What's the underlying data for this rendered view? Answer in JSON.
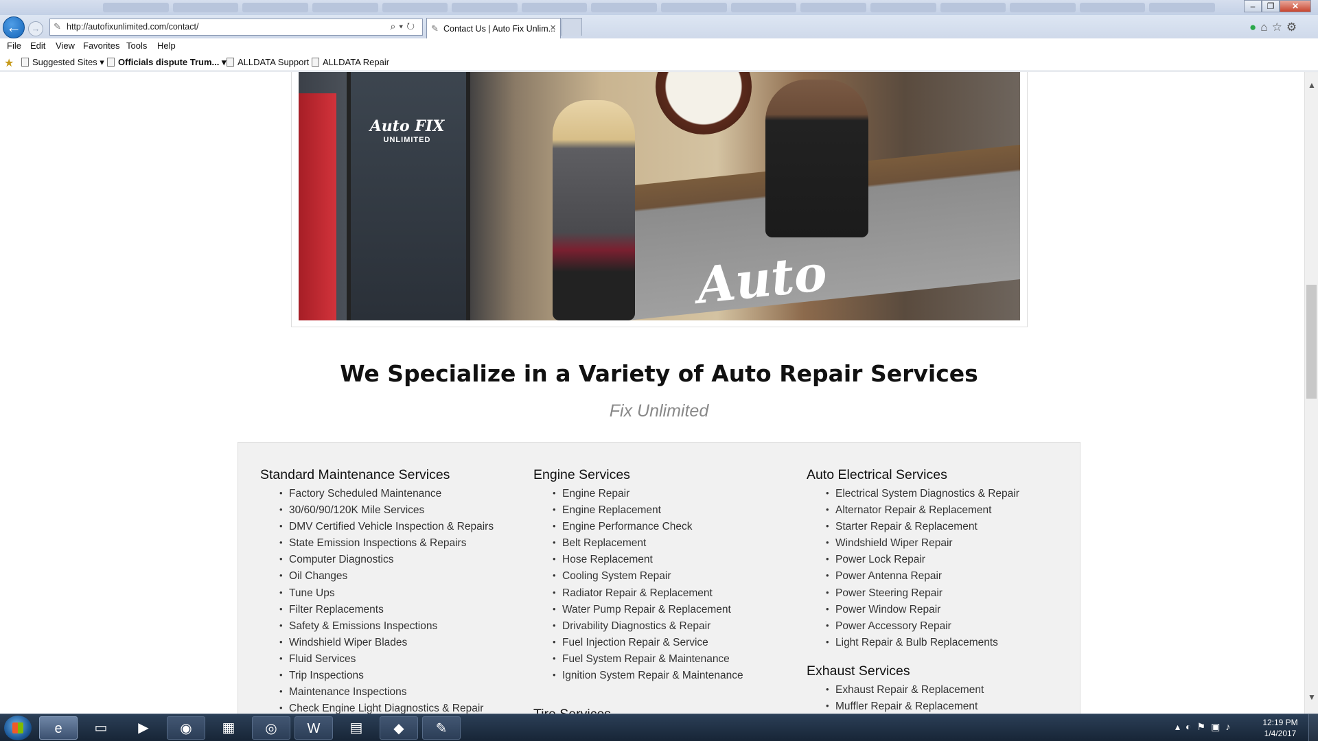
{
  "browser": {
    "url": "http://autofixunlimited.com/contact/",
    "tab_title": "Contact Us | Auto Fix Unlim...",
    "menu": [
      "File",
      "Edit",
      "View",
      "Favorites",
      "Tools",
      "Help"
    ],
    "favorites": [
      {
        "label": "Suggested Sites ▾",
        "bold": false
      },
      {
        "label": "Officials dispute Trum... ▾",
        "bold": true
      },
      {
        "label": "ALLDATA Support",
        "bold": false
      },
      {
        "label": "ALLDATA Repair",
        "bold": false
      }
    ]
  },
  "page": {
    "hero_image": {
      "logo_text": "Auto FIX",
      "logo_sub": "UNLIMITED",
      "counter_text": "Auto"
    },
    "heading": "We Specialize in a Variety of Auto Repair Services",
    "subheading": "Fix Unlimited",
    "columns": [
      {
        "sections": [
          {
            "title": "Standard Maintenance Services",
            "items": [
              "Factory Scheduled Maintenance",
              "30/60/90/120K Mile Services",
              "DMV Certified Vehicle Inspection & Repairs",
              "State Emission Inspections & Repairs",
              "Computer Diagnostics",
              "Oil Changes",
              "Tune Ups",
              "Filter Replacements",
              "Safety & Emissions Inspections",
              "Windshield Wiper Blades",
              "Fluid Services",
              "Trip Inspections",
              "Maintenance Inspections",
              "Check Engine Light Diagnostics & Repair"
            ]
          }
        ]
      },
      {
        "sections": [
          {
            "title": "Engine Services",
            "items": [
              "Engine Repair",
              "Engine Replacement",
              "Engine Performance Check",
              "Belt Replacement",
              "Hose Replacement",
              "Cooling System Repair",
              "Radiator Repair & Replacement",
              "Water Pump Repair & Replacement",
              "Drivability Diagnostics & Repair",
              "Fuel Injection Repair & Service",
              "Fuel System Repair & Maintenance",
              "Ignition System Repair & Maintenance"
            ]
          },
          {
            "title": "Tire Services",
            "items": []
          }
        ]
      },
      {
        "sections": [
          {
            "title": "Auto Electrical Services",
            "items": [
              "Electrical System Diagnostics & Repair",
              "Alternator Repair & Replacement",
              "Starter Repair & Replacement",
              "Windshield Wiper Repair",
              "Power Lock Repair",
              "Power Antenna Repair",
              "Power Steering Repair",
              "Power Window Repair",
              "Power Accessory Repair",
              "Light Repair & Bulb Replacements"
            ]
          },
          {
            "title": "Exhaust Services",
            "items": [
              "Exhaust Repair & Replacement",
              "Muffler Repair & Replacement"
            ]
          }
        ]
      }
    ]
  },
  "taskbar": {
    "time": "12:19 PM",
    "date": "1/4/2017",
    "apps": [
      {
        "name": "internet-explorer",
        "glyph": "e",
        "state": "active"
      },
      {
        "name": "file-explorer",
        "glyph": "▭",
        "state": "none"
      },
      {
        "name": "media-player",
        "glyph": "▶",
        "state": "none"
      },
      {
        "name": "firefox",
        "glyph": "◉",
        "state": "open"
      },
      {
        "name": "calculator",
        "glyph": "▦",
        "state": "none"
      },
      {
        "name": "chrome",
        "glyph": "◎",
        "state": "open"
      },
      {
        "name": "word",
        "glyph": "W",
        "state": "open"
      },
      {
        "name": "sticky-notes",
        "glyph": "▤",
        "state": "none"
      },
      {
        "name": "app-red",
        "glyph": "◆",
        "state": "open"
      },
      {
        "name": "paint",
        "glyph": "✎",
        "state": "open"
      }
    ]
  },
  "colors": {
    "ie_blue": "#1464b8",
    "panel_bg": "#f1f1f1",
    "heading": "#111111",
    "subheading": "#888888"
  }
}
